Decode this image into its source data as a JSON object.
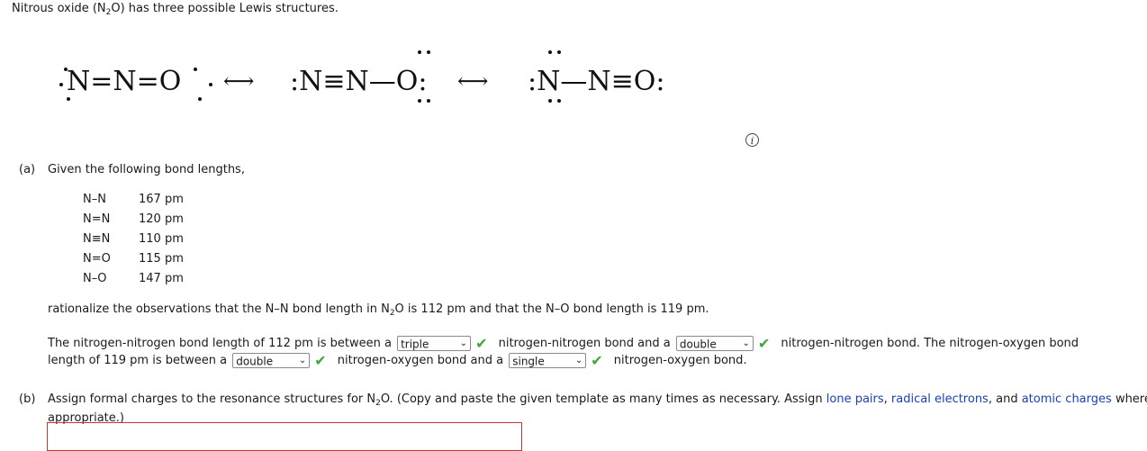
{
  "intro": {
    "before": "Nitrous oxide (N",
    "sub": "2",
    "after": "O) has three possible Lewis structures."
  },
  "structures": {
    "s1": "N=N=O",
    "s2": ":N≡N—O:",
    "s3": ":N—N≡O:",
    "arrow": "⟷"
  },
  "part_a": {
    "label": "(a)",
    "prompt": "Given the following bond lengths,",
    "bonds": [
      {
        "bond": "N–N",
        "length": "167 pm"
      },
      {
        "bond": "N=N",
        "length": "120 pm"
      },
      {
        "bond": "N≡N",
        "length": "110 pm"
      },
      {
        "bond": "N=O",
        "length": "115 pm"
      },
      {
        "bond": "N–O",
        "length": "147 pm"
      }
    ],
    "rationalize_before": "rationalize the observations that the N–N bond length in N",
    "rationalize_sub": "2",
    "rationalize_after": "O is 112 pm and that the N–O bond length is 119 pm.",
    "line1_a": "The nitrogen-nitrogen bond length of 112 pm is between a",
    "select1": "triple",
    "line1_b": "nitrogen-nitrogen bond and a",
    "select2": "double",
    "line1_c": "nitrogen-nitrogen bond. The nitrogen-oxygen bond",
    "line2_a": "length of 119 pm is between a",
    "select3": "double",
    "line2_b": "nitrogen-oxygen bond and a",
    "select4": "single",
    "line2_c": "nitrogen-oxygen bond."
  },
  "part_b": {
    "label": "(b)",
    "text_before": "Assign formal charges to the resonance structures for N",
    "text_sub": "2",
    "text_after": "O. (Copy and paste the given template as many times as necessary. Assign",
    "link1": "lone pairs",
    "link2": "radical electrons",
    "and": "and",
    "link3": "atomic charges",
    "where": "where",
    "line2": "appropriate.)"
  },
  "icons": {
    "info": "i",
    "check": "✔",
    "caret": "⌄"
  },
  "colors": {
    "check": "#3aa83a",
    "link": "#1a3fb3",
    "template_border": "#c0392b"
  }
}
